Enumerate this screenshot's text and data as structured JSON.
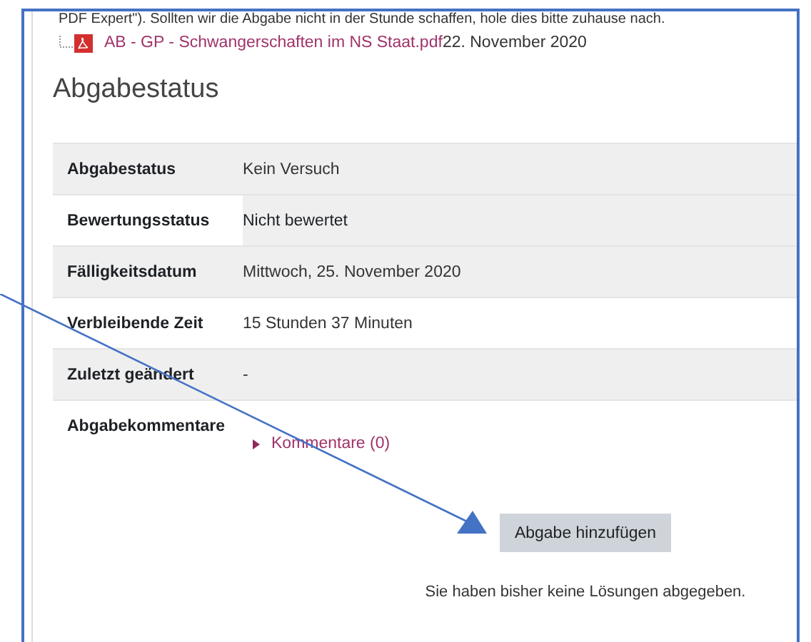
{
  "intro_text": "PDF Expert\"). Sollten wir die Abgabe nicht in der Stunde schaffen, hole dies bitte zuhause nach.",
  "attachment": {
    "name": "AB - GP - Schwangerschaften im NS Staat.pdf",
    "date": "22. November 2020"
  },
  "heading": "Abgabestatus",
  "rows": [
    {
      "label": "Abgabestatus",
      "value": "Kein Versuch",
      "shaded": true,
      "hovered": false
    },
    {
      "label": "Bewertungsstatus",
      "value": "Nicht bewertet",
      "shaded": false,
      "hovered": true
    },
    {
      "label": "Fälligkeitsdatum",
      "value": "Mittwoch, 25. November 2020",
      "shaded": true,
      "hovered": false
    },
    {
      "label": "Verbleibende Zeit",
      "value": "15 Stunden 37 Minuten",
      "shaded": false,
      "hovered": false
    },
    {
      "label": "Zuletzt geändert",
      "value": "-",
      "shaded": true,
      "hovered": false
    },
    {
      "label": "Abgabekommentare",
      "kind": "comments",
      "link": "Kommentare (0)",
      "expanded": false,
      "shaded": false,
      "hovered": false
    }
  ],
  "submit_button": "Abgabe hinzufügen",
  "submit_note": "Sie haben bisher keine Lösungen abgegeben."
}
